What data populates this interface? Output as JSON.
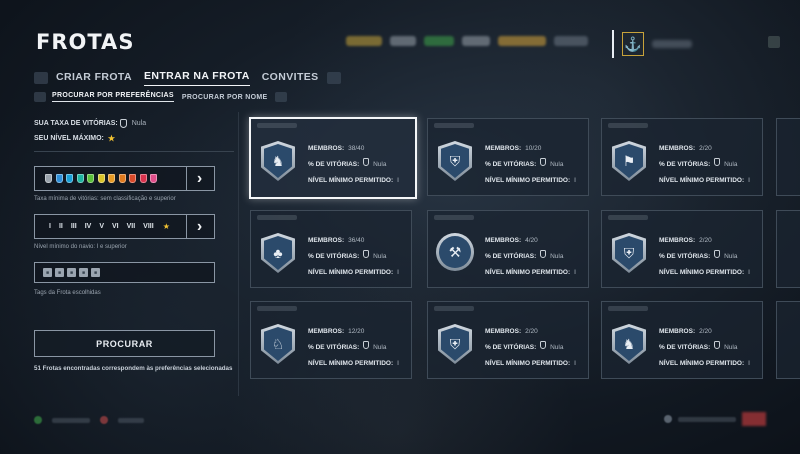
{
  "title": "FROTAS",
  "tabs": [
    {
      "label": "CRIAR FROTA",
      "active": false
    },
    {
      "label": "ENTRAR NA FROTA",
      "active": true
    },
    {
      "label": "CONVITES",
      "active": false
    }
  ],
  "subtabs": [
    {
      "label": "PROCURAR POR PREFERÊNCIAS",
      "active": true
    },
    {
      "label": "PROCURAR POR NOME",
      "active": false
    }
  ],
  "left": {
    "win_rate_label": "SUA TAXA DE VITÓRIAS:",
    "win_rate_value": "Nula",
    "max_level_label": "SEU NÍVEL MÁXIMO:",
    "max_level_icon": "star-icon",
    "win_rate_filter_caption": "Taxa mínima de vitórias: sem classificação e superior",
    "tier_filter_caption": "Nível mínimo do navio: I e superior",
    "tags_caption": "Tags da Frota escolhidas",
    "search_button": "PROCURAR",
    "results_text": "51 Frotas encontradas correspondem às preferências selecionadas",
    "swatch_colors": [
      "#9aa3ac",
      "#2f8fd8",
      "#1a9fd6",
      "#1fb3a0",
      "#5bbf3a",
      "#d9c32a",
      "#e69a26",
      "#e07a1f",
      "#d94a2a",
      "#d9334e",
      "#e04e8a"
    ],
    "tiers": [
      "I",
      "II",
      "III",
      "IV",
      "V",
      "VI",
      "VII",
      "VIII"
    ],
    "tier_star": "★"
  },
  "cards_labels": {
    "members": "MEMBROS:",
    "winrate": "% DE VITÓRIAS:",
    "min_level": "NÍVEL MÍNIMO PERMITIDO:"
  },
  "cards": [
    {
      "members": "38/40",
      "winrate": "Nula",
      "min_level": "I",
      "emblem": "lion-emblem-icon",
      "glyph": "♞",
      "selected": true
    },
    {
      "members": "10/20",
      "winrate": "Nula",
      "min_level": "I",
      "emblem": "helmet-emblem-icon",
      "glyph": "⛨",
      "selected": false
    },
    {
      "members": "2/20",
      "winrate": "Nula",
      "min_level": "I",
      "emblem": "flag-emblem-icon",
      "glyph": "⚑",
      "selected": false
    },
    {
      "members": "36/40",
      "winrate": "Nula",
      "min_level": "I",
      "emblem": "duck-emblem-icon",
      "glyph": "♣",
      "selected": false
    },
    {
      "members": "4/20",
      "winrate": "Nula",
      "min_level": "I",
      "emblem": "crossed-hammers-emblem-icon",
      "glyph": "⚒",
      "selected": false
    },
    {
      "members": "2/20",
      "winrate": "Nula",
      "min_level": "I",
      "emblem": "helmet-emblem-icon",
      "glyph": "⛨",
      "selected": false
    },
    {
      "members": "12/20",
      "winrate": "Nula",
      "min_level": "I",
      "emblem": "wolf-emblem-icon",
      "glyph": "♘",
      "selected": false
    },
    {
      "members": "2/20",
      "winrate": "Nula",
      "min_level": "I",
      "emblem": "helmet-emblem-icon",
      "glyph": "⛨",
      "selected": false
    },
    {
      "members": "2/20",
      "winrate": "Nula",
      "min_level": "I",
      "emblem": "lion-emblem-icon",
      "glyph": "♞",
      "selected": false
    }
  ]
}
